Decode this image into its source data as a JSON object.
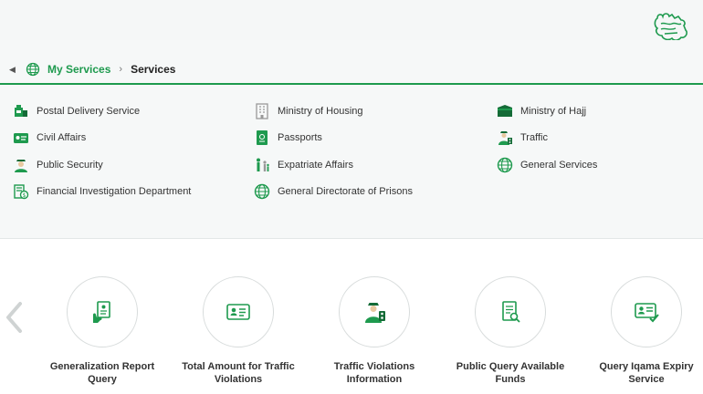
{
  "breadcrumb": {
    "root": "My Services",
    "separator": "›",
    "current": "Services"
  },
  "services": {
    "col1": [
      {
        "label": "Postal Delivery Service",
        "icon": "postal-icon"
      },
      {
        "label": "Civil Affairs",
        "icon": "id-card-icon"
      },
      {
        "label": "Public Security",
        "icon": "officer-icon"
      },
      {
        "label": "Financial Investigation Department",
        "icon": "finance-icon"
      }
    ],
    "col2": [
      {
        "label": "Ministry of Housing",
        "icon": "building-icon"
      },
      {
        "label": "Passports",
        "icon": "passport-icon"
      },
      {
        "label": "Expatriate Affairs",
        "icon": "family-icon"
      },
      {
        "label": "General Directorate of Prisons",
        "icon": "globe-icon"
      }
    ],
    "col3": [
      {
        "label": "Ministry of Hajj",
        "icon": "kaaba-icon"
      },
      {
        "label": "Traffic",
        "icon": "traffic-officer-icon"
      },
      {
        "label": "General Services",
        "icon": "globe-icon"
      }
    ]
  },
  "carousel": [
    {
      "line1": "Generalization Report",
      "line2": "Query",
      "icon": "report-icon"
    },
    {
      "line1": "Total Amount for Traffic",
      "line2": "Violations",
      "icon": "id-card-icon"
    },
    {
      "line1": "Traffic Violations",
      "line2": "Information",
      "icon": "traffic-officer-icon"
    },
    {
      "line1": "Public Query Available",
      "line2": "Funds",
      "icon": "document-search-icon"
    },
    {
      "line1": "Query Iqama Expiry",
      "line2": "Service",
      "icon": "iqama-check-icon"
    }
  ],
  "colors": {
    "accent": "#1e9a4e",
    "panel": "#f6f8f8"
  }
}
